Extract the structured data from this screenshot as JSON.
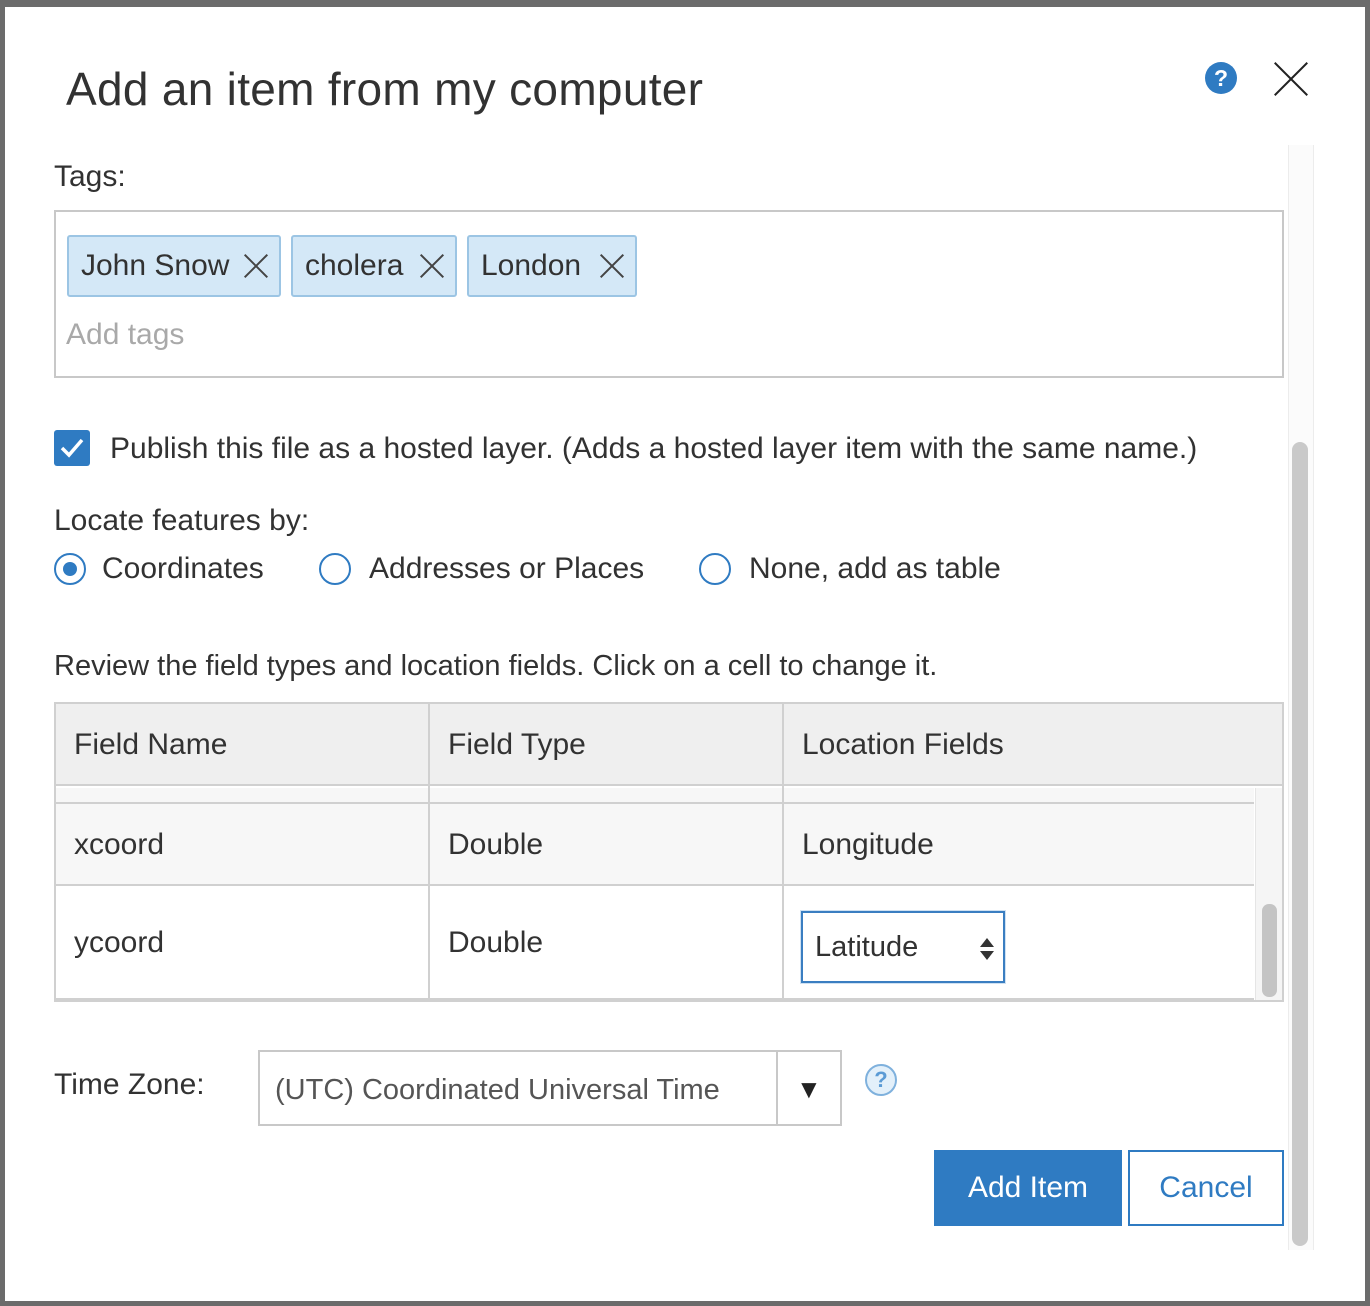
{
  "dialog": {
    "title": "Add an item from my computer",
    "help_glyph": "?",
    "close_icon": "close-icon"
  },
  "tags": {
    "label": "Tags:",
    "items": [
      {
        "label": "John Snow"
      },
      {
        "label": "cholera"
      },
      {
        "label": "London"
      }
    ],
    "placeholder": "Add tags"
  },
  "publish": {
    "checked": true,
    "label": "Publish this file as a hosted layer. (Adds a hosted layer item with the same name.)"
  },
  "locate": {
    "label": "Locate features by:",
    "options": [
      {
        "label": "Coordinates",
        "selected": true
      },
      {
        "label": "Addresses or Places",
        "selected": false
      },
      {
        "label": "None, add as table",
        "selected": false
      }
    ]
  },
  "fields": {
    "instructions": "Review the field types and location fields. Click on a cell to change it.",
    "columns": [
      "Field Name",
      "Field Type",
      "Location Fields"
    ],
    "rows": [
      {
        "name": "xcoord",
        "type": "Double",
        "location": "Longitude"
      },
      {
        "name": "ycoord",
        "type": "Double",
        "location": "Latitude"
      }
    ]
  },
  "timezone": {
    "label": "Time Zone:",
    "value": "(UTC) Coordinated Universal Time",
    "help_glyph": "?"
  },
  "actions": {
    "add_label": "Add Item",
    "cancel_label": "Cancel"
  },
  "colors": {
    "accent": "#2f7bc2",
    "tag_bg": "#d4e8f7",
    "header_bg": "#efefef"
  }
}
